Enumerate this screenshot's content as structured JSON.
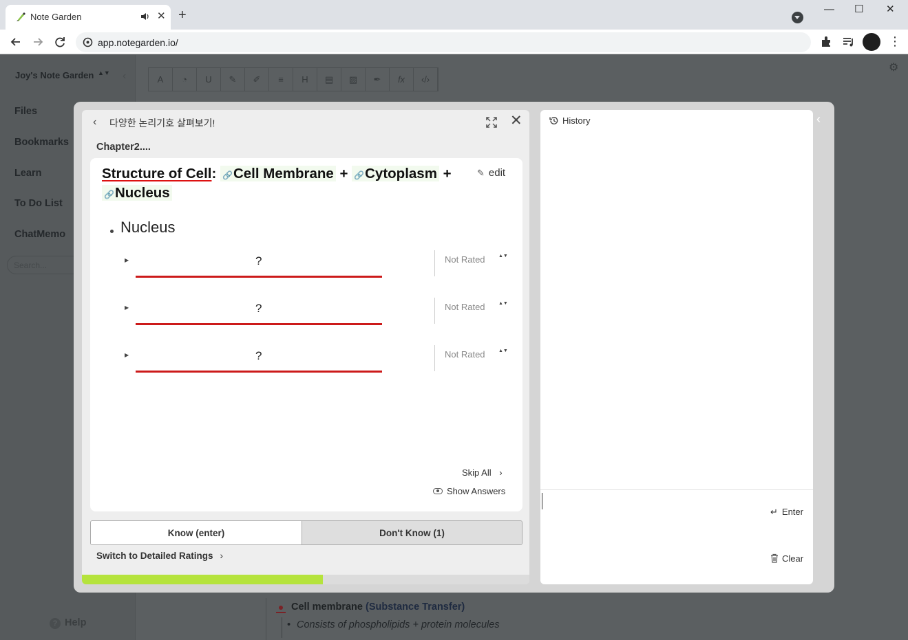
{
  "browser": {
    "tab_title": "Note Garden",
    "tab_close": "✕",
    "new_tab": "+",
    "url": "app.notegarden.io/",
    "window_controls": {
      "minimize": "—",
      "maximize": "☐",
      "close": "✕"
    },
    "menu_glyph": "⋮"
  },
  "sidebar": {
    "workspace": "Joy's Note Garden",
    "workspace_caret": "▲▼",
    "collapse_glyph": "‹",
    "items": [
      {
        "label": "Files"
      },
      {
        "label": "Bookmarks"
      },
      {
        "label": "Learn"
      },
      {
        "label": "To Do List"
      },
      {
        "label": "ChatMemo"
      }
    ],
    "search_placeholder": "Search...",
    "help": {
      "icon": "?",
      "label": "Help"
    }
  },
  "editor_toolbar": {
    "buttons": [
      "A",
      "◔",
      "U",
      "✎",
      "✐",
      "≡",
      "H",
      "▤",
      "▨",
      "✒",
      "fx",
      "‹/›"
    ]
  },
  "background_note": {
    "line1_main": "Cell membrane",
    "line1_paren": "(Substance Transfer)",
    "line2": "Consists of phospholipids + protein molecules"
  },
  "modal": {
    "back_glyph": "‹",
    "title": "다양한 논리기호 살펴보기!",
    "close_glyph": "✕",
    "chapter": "Chapter2....",
    "card": {
      "title_struct": "Structure of Cell",
      "title_colon": ":",
      "link_glyph": "🔗",
      "plus": "+",
      "chips": [
        "Cell Membrane",
        "Cytoplasm",
        "Nucleus"
      ],
      "edit_label": "edit",
      "edit_glyph": "✎",
      "bullet": "Nucleus",
      "questions": [
        {
          "caret": "▶",
          "text": "?",
          "rating": "Not Rated",
          "spin": "▲▼"
        },
        {
          "caret": "▶",
          "text": "?",
          "rating": "Not Rated",
          "spin": "▲▼"
        },
        {
          "caret": "▶",
          "text": "?",
          "rating": "Not Rated",
          "spin": "▲▼"
        }
      ],
      "skip_all": "Skip All",
      "skip_chev": "›",
      "show_answers": "Show Answers"
    },
    "know_label": "Know (enter)",
    "dont_know_label": "Don't Know (1)",
    "switch_label": "Switch to Detailed Ratings",
    "switch_chev": "›",
    "progress_fraction": 0.539,
    "history": {
      "title": "History",
      "input_value": "",
      "enter_label": "Enter",
      "enter_glyph": "↵",
      "clear_label": "Clear",
      "collapse_glyph": "‹"
    }
  },
  "colors": {
    "accent_green": "#b5e33c",
    "underline_red": "#cc1a1a",
    "chip_bg": "#f2faee"
  },
  "icons": {
    "favicon": "leaf-pen-icon",
    "audio": "speaker-icon",
    "expand": "expand-icon",
    "history": "history-icon",
    "trash": "trash-icon",
    "eye": "eye-icon"
  }
}
